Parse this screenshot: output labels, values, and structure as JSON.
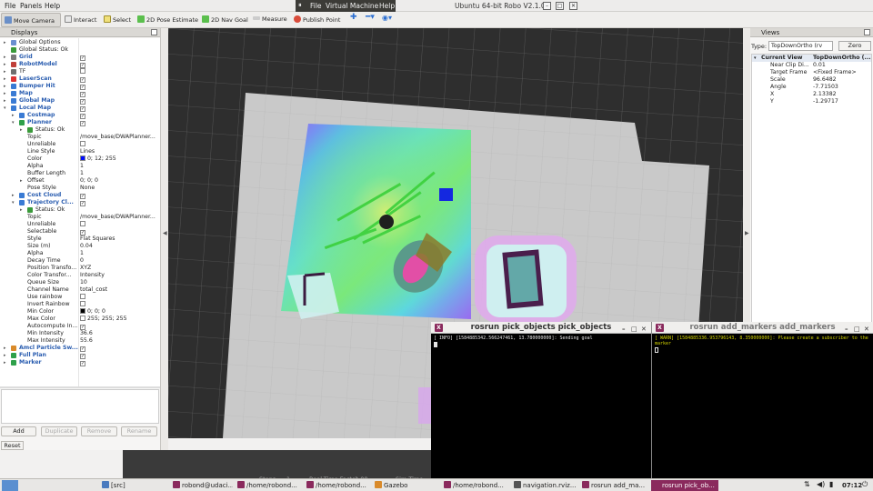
{
  "menubar": {
    "file": "File",
    "panels": "Panels",
    "help": "Help"
  },
  "vm_menu": {
    "icon": "pause-icon",
    "file": "File",
    "vm": "Virtual Machine",
    "help": "Help"
  },
  "window_title": "Ubuntu 64-bit Robo V2.1.0",
  "toolbar": {
    "move_camera": "Move Camera",
    "interact": "Interact",
    "select": "Select",
    "pose_estimate": "2D Pose Estimate",
    "nav_goal": "2D Nav Goal",
    "measure": "Measure",
    "publish_point": "Publish Point"
  },
  "displays": {
    "title": "Displays",
    "rows": [
      {
        "name": "Global Options",
        "value": ""
      },
      {
        "name": "Global Status: Ok",
        "value": ""
      },
      {
        "name": "Grid",
        "value": "✓"
      },
      {
        "name": "RobotModel",
        "value": "✓"
      },
      {
        "name": "TF",
        "value": ""
      },
      {
        "name": "LaserScan",
        "value": "✓"
      },
      {
        "name": "Bumper Hit",
        "value": "✓"
      },
      {
        "name": "Map",
        "value": "✓"
      },
      {
        "name": "Global Map",
        "value": "✓"
      },
      {
        "name": "Local Map",
        "value": "✓"
      },
      {
        "name": "Costmap",
        "value": "✓"
      },
      {
        "name": "Planner",
        "value": "✓"
      },
      {
        "name": "Status: Ok",
        "value": ""
      },
      {
        "name": "Topic",
        "value": "/move_base/DWAPlanner..."
      },
      {
        "name": "Unreliable",
        "value": ""
      },
      {
        "name": "Line Style",
        "value": "Lines"
      },
      {
        "name": "Color",
        "value": "0; 12; 255"
      },
      {
        "name": "Alpha",
        "value": "1"
      },
      {
        "name": "Buffer Length",
        "value": "1"
      },
      {
        "name": "Offset",
        "value": "0; 0; 0"
      },
      {
        "name": "Pose Style",
        "value": "None"
      },
      {
        "name": "Cost Cloud",
        "value": "✓"
      },
      {
        "name": "Trajectory Cl...",
        "value": "✓"
      },
      {
        "name": "Status: Ok",
        "value": ""
      },
      {
        "name": "Topic",
        "value": "/move_base/DWAPlanner..."
      },
      {
        "name": "Unreliable",
        "value": ""
      },
      {
        "name": "Selectable",
        "value": "✓"
      },
      {
        "name": "Style",
        "value": "Flat Squares"
      },
      {
        "name": "Size (m)",
        "value": "0.04"
      },
      {
        "name": "Alpha",
        "value": "1"
      },
      {
        "name": "Decay Time",
        "value": "0"
      },
      {
        "name": "Position Transfo...",
        "value": "XYZ"
      },
      {
        "name": "Color Transfor...",
        "value": "Intensity"
      },
      {
        "name": "Queue Size",
        "value": "10"
      },
      {
        "name": "Channel Name",
        "value": "total_cost"
      },
      {
        "name": "Use rainbow",
        "value": ""
      },
      {
        "name": "Invert Rainbow",
        "value": ""
      },
      {
        "name": "Min Color",
        "value": "0; 0; 0"
      },
      {
        "name": "Max Color",
        "value": "255; 255; 255"
      },
      {
        "name": "Autocompute In...",
        "value": "✓"
      },
      {
        "name": "Min Intensity",
        "value": "36.6"
      },
      {
        "name": "Max Intensity",
        "value": "55.6"
      },
      {
        "name": "Amcl Particle Sw...",
        "value": "✓"
      },
      {
        "name": "Full Plan",
        "value": "✓"
      },
      {
        "name": "Marker",
        "value": "✓"
      }
    ],
    "add": "Add",
    "duplicate": "Duplicate",
    "remove": "Remove",
    "rename": "Rename",
    "reset": "Reset"
  },
  "views": {
    "title": "Views",
    "type_label": "Type:",
    "type_value": "TopDownOrtho (rv",
    "zero": "Zero",
    "current_view": "Current View",
    "current_view_value": "TopDownOrtho (...",
    "props": [
      {
        "key": "Near Clip Di...",
        "value": "0.01"
      },
      {
        "key": "Target Frame",
        "value": "<Fixed Frame>"
      },
      {
        "key": "Scale",
        "value": "96.6482"
      },
      {
        "key": "Angle",
        "value": "-7.71503"
      },
      {
        "key": "X",
        "value": "2.13382"
      },
      {
        "key": "Y",
        "value": "-1.29717"
      }
    ]
  },
  "terminal1": {
    "title": "rosrun pick_objects pick_objects",
    "text": "[ INFO] [1584885342.566247461, 13.780000000]: Sending goal"
  },
  "terminal2": {
    "title": "rosrun add_markers add_markers",
    "text": "[ WARN] [1584885336.953796143, 8.350000000]: Please create a subscriber to the marker"
  },
  "rviz_bottom": {
    "steps": "Steps",
    "one": "1",
    "rtf": "Real-Time Factor",
    "rtf_val": "1.00",
    "sim": "Sim Time"
  },
  "taskbar": {
    "items": [
      "[src]",
      "robond@udaci...",
      "/home/robond...",
      "/home/robond...",
      "Gazebo",
      "/home/robond...",
      "navigation.rviz...",
      "rosrun add_ma...",
      "rosrun pick_ob..."
    ],
    "clock": "07:12"
  },
  "colors": {
    "accent": "#2a5db0",
    "terminal_bg": "#000000",
    "warn_text": "#d4d400"
  }
}
